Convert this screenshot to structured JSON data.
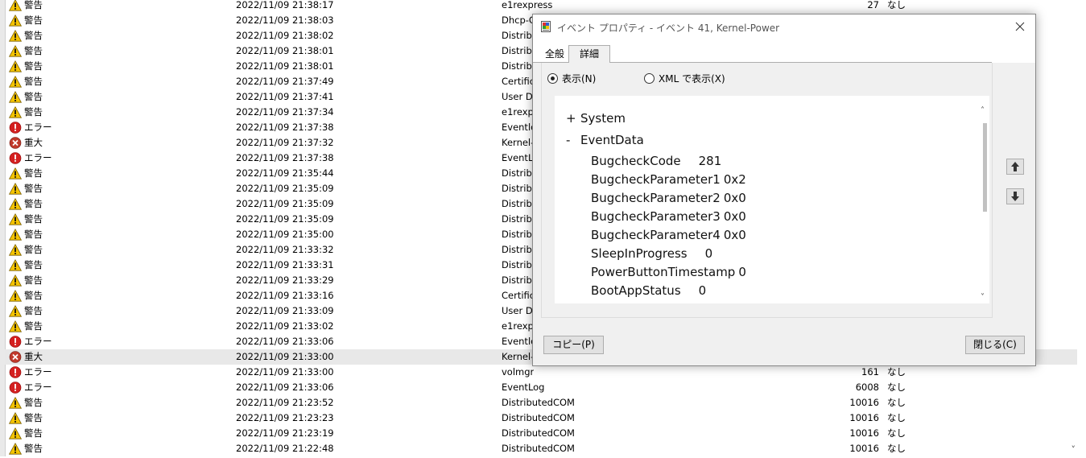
{
  "event_list": {
    "rows": [
      {
        "level": "警告",
        "level_icon": "warning-icon",
        "date": "2022/11/09 21:38:17",
        "source": "e1rexpress",
        "event_id": "27",
        "category": "なし"
      },
      {
        "level": "警告",
        "level_icon": "warning-icon",
        "date": "2022/11/09 21:38:03",
        "source": "Dhcp-C",
        "event_id": "",
        "category": ""
      },
      {
        "level": "警告",
        "level_icon": "warning-icon",
        "date": "2022/11/09 21:38:02",
        "source": "Distribu",
        "event_id": "",
        "category": ""
      },
      {
        "level": "警告",
        "level_icon": "warning-icon",
        "date": "2022/11/09 21:38:01",
        "source": "Distribu",
        "event_id": "",
        "category": ""
      },
      {
        "level": "警告",
        "level_icon": "warning-icon",
        "date": "2022/11/09 21:38:01",
        "source": "Distribu",
        "event_id": "",
        "category": ""
      },
      {
        "level": "警告",
        "level_icon": "warning-icon",
        "date": "2022/11/09 21:37:49",
        "source": "Certifica",
        "event_id": "",
        "category": ""
      },
      {
        "level": "警告",
        "level_icon": "warning-icon",
        "date": "2022/11/09 21:37:41",
        "source": "User De",
        "event_id": "",
        "category": ""
      },
      {
        "level": "警告",
        "level_icon": "warning-icon",
        "date": "2022/11/09 21:37:34",
        "source": "e1rexpr",
        "event_id": "",
        "category": ""
      },
      {
        "level": "エラー",
        "level_icon": "error-icon",
        "date": "2022/11/09 21:37:38",
        "source": "Eventlo",
        "event_id": "",
        "category": ""
      },
      {
        "level": "重大",
        "level_icon": "critical-icon",
        "date": "2022/11/09 21:37:32",
        "source": "Kernel-",
        "event_id": "",
        "category": ""
      },
      {
        "level": "エラー",
        "level_icon": "error-icon",
        "date": "2022/11/09 21:37:38",
        "source": "EventLo",
        "event_id": "",
        "category": ""
      },
      {
        "level": "警告",
        "level_icon": "warning-icon",
        "date": "2022/11/09 21:35:44",
        "source": "Distribu",
        "event_id": "",
        "category": ""
      },
      {
        "level": "警告",
        "level_icon": "warning-icon",
        "date": "2022/11/09 21:35:09",
        "source": "Distribu",
        "event_id": "",
        "category": ""
      },
      {
        "level": "警告",
        "level_icon": "warning-icon",
        "date": "2022/11/09 21:35:09",
        "source": "Distribu",
        "event_id": "",
        "category": ""
      },
      {
        "level": "警告",
        "level_icon": "warning-icon",
        "date": "2022/11/09 21:35:09",
        "source": "Distribu",
        "event_id": "",
        "category": ""
      },
      {
        "level": "警告",
        "level_icon": "warning-icon",
        "date": "2022/11/09 21:35:00",
        "source": "Distribu",
        "event_id": "",
        "category": ""
      },
      {
        "level": "警告",
        "level_icon": "warning-icon",
        "date": "2022/11/09 21:33:32",
        "source": "Distribu",
        "event_id": "",
        "category": ""
      },
      {
        "level": "警告",
        "level_icon": "warning-icon",
        "date": "2022/11/09 21:33:31",
        "source": "Distribu",
        "event_id": "",
        "category": ""
      },
      {
        "level": "警告",
        "level_icon": "warning-icon",
        "date": "2022/11/09 21:33:29",
        "source": "Distribu",
        "event_id": "",
        "category": ""
      },
      {
        "level": "警告",
        "level_icon": "warning-icon",
        "date": "2022/11/09 21:33:16",
        "source": "Certifica",
        "event_id": "",
        "category": ""
      },
      {
        "level": "警告",
        "level_icon": "warning-icon",
        "date": "2022/11/09 21:33:09",
        "source": "User De",
        "event_id": "",
        "category": ""
      },
      {
        "level": "警告",
        "level_icon": "warning-icon",
        "date": "2022/11/09 21:33:02",
        "source": "e1rexpr",
        "event_id": "",
        "category": ""
      },
      {
        "level": "エラー",
        "level_icon": "error-icon",
        "date": "2022/11/09 21:33:06",
        "source": "Eventlo",
        "event_id": "",
        "category": ""
      },
      {
        "level": "重大",
        "level_icon": "critical-icon",
        "date": "2022/11/09 21:33:00",
        "source": "Kernel-",
        "event_id": "",
        "category": "",
        "selected": true
      },
      {
        "level": "エラー",
        "level_icon": "error-icon",
        "date": "2022/11/09 21:33:00",
        "source": "volmgr",
        "event_id": "161",
        "category": "なし"
      },
      {
        "level": "エラー",
        "level_icon": "error-icon",
        "date": "2022/11/09 21:33:06",
        "source": "EventLog",
        "event_id": "6008",
        "category": "なし"
      },
      {
        "level": "警告",
        "level_icon": "warning-icon",
        "date": "2022/11/09 21:23:52",
        "source": "DistributedCOM",
        "event_id": "10016",
        "category": "なし"
      },
      {
        "level": "警告",
        "level_icon": "warning-icon",
        "date": "2022/11/09 21:23:23",
        "source": "DistributedCOM",
        "event_id": "10016",
        "category": "なし"
      },
      {
        "level": "警告",
        "level_icon": "warning-icon",
        "date": "2022/11/09 21:23:19",
        "source": "DistributedCOM",
        "event_id": "10016",
        "category": "なし"
      },
      {
        "level": "警告",
        "level_icon": "warning-icon",
        "date": "2022/11/09 21:22:48",
        "source": "DistributedCOM",
        "event_id": "10016",
        "category": "なし"
      }
    ]
  },
  "dialog": {
    "title": "イベント プロパティ - イベント 41, Kernel-Power",
    "tabs": [
      "全般",
      "詳細"
    ],
    "active_tab": "詳細",
    "radio_friendly": "表示(N)",
    "radio_xml": "XML で表示(X)",
    "selected_view": "表示(N)",
    "tree": {
      "system": {
        "toggle": "+",
        "label": "System"
      },
      "eventdata": {
        "toggle": "-",
        "label": "EventData"
      }
    },
    "event_data": [
      {
        "key": "BugcheckCode",
        "value": "281"
      },
      {
        "key": "BugcheckParameter1",
        "value": "0x2"
      },
      {
        "key": "BugcheckParameter2",
        "value": "0x0"
      },
      {
        "key": "BugcheckParameter3",
        "value": "0x0"
      },
      {
        "key": "BugcheckParameter4",
        "value": "0x0"
      },
      {
        "key": "SleepInProgress",
        "value": "0"
      },
      {
        "key": "PowerButtonTimestamp",
        "value": "0"
      },
      {
        "key": "BootAppStatus",
        "value": "0"
      }
    ],
    "copy_button": "コピー(P)",
    "close_button": "閉じる(C)"
  },
  "colors": {
    "warning": "#f5c400",
    "error": "#d42020",
    "critical_bg": "#c0392b",
    "selected_row": "#e8e8e8"
  }
}
